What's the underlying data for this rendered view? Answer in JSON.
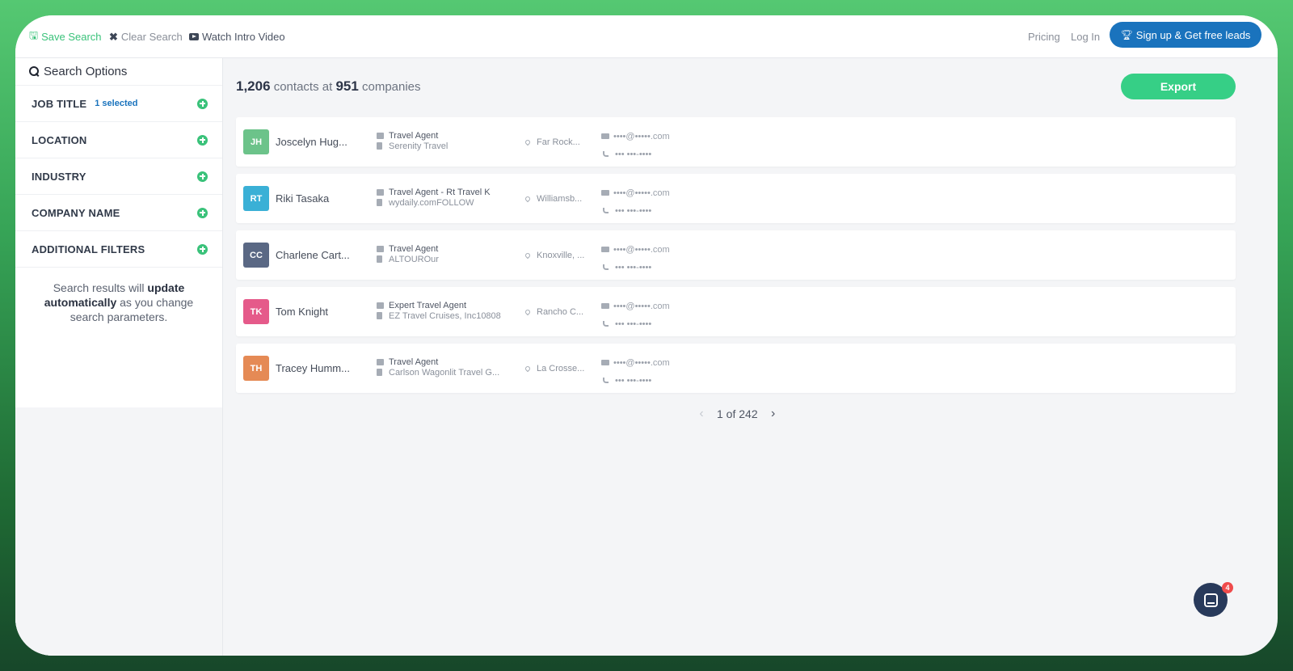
{
  "topbar": {
    "save_search": "Save Search",
    "clear_search": "Clear Search",
    "watch_video": "Watch Intro Video",
    "pricing": "Pricing",
    "login": "Log In",
    "signup": "Sign up & Get free leads"
  },
  "sidebar": {
    "title": "Search Options",
    "filters": [
      {
        "label": "JOB TITLE",
        "selected": "1 selected"
      },
      {
        "label": "LOCATION",
        "selected": ""
      },
      {
        "label": "INDUSTRY",
        "selected": ""
      },
      {
        "label": "COMPANY NAME",
        "selected": ""
      },
      {
        "label": "ADDITIONAL FILTERS",
        "selected": ""
      }
    ],
    "hint": {
      "part1": "Search results will ",
      "bold1": "update",
      "bold2": "automatically",
      "part2": " as you change search parameters."
    }
  },
  "summary": {
    "contacts": "1,206",
    "contacts_label": "contacts at",
    "companies": "951",
    "companies_label": "companies"
  },
  "export_label": "Export",
  "results": [
    {
      "initials": "JH",
      "color": "#6cc38a",
      "name": "Joscelyn Hug...",
      "title": "Travel Agent",
      "company": "Serenity Travel",
      "location": "Far Rock...",
      "email": "••••@•••••.com",
      "phone": "••• •••-••••"
    },
    {
      "initials": "RT",
      "color": "#3ab0d6",
      "name": "Riki Tasaka",
      "title": "Travel Agent - Rt Travel K",
      "company": "wydaily.comFOLLOW",
      "location": "Williamsb...",
      "email": "••••@•••••.com",
      "phone": "••• •••-••••"
    },
    {
      "initials": "CC",
      "color": "#5a6884",
      "name": "Charlene Cart...",
      "title": "Travel Agent",
      "company": "ALTOUROur",
      "location": "Knoxville, ...",
      "email": "••••@•••••.com",
      "phone": "••• •••-••••"
    },
    {
      "initials": "TK",
      "color": "#e55a8a",
      "name": "Tom Knight",
      "title": "Expert Travel Agent",
      "company": "EZ Travel Cruises, Inc10808",
      "location": "Rancho C...",
      "email": "••••@•••••.com",
      "phone": "••• •••-••••"
    },
    {
      "initials": "TH",
      "color": "#e58a55",
      "name": "Tracey Humm...",
      "title": "Travel Agent",
      "company": "Carlson Wagonlit Travel G...",
      "location": "La Crosse...",
      "email": "••••@•••••.com",
      "phone": "••• •••-••••"
    }
  ],
  "pagination": {
    "label": "1 of 242"
  },
  "chat": {
    "badge": "4"
  },
  "colors": {
    "accent_green": "#36cf86",
    "brand_blue": "#1a73bd",
    "badge_red": "#ef4b4b"
  }
}
